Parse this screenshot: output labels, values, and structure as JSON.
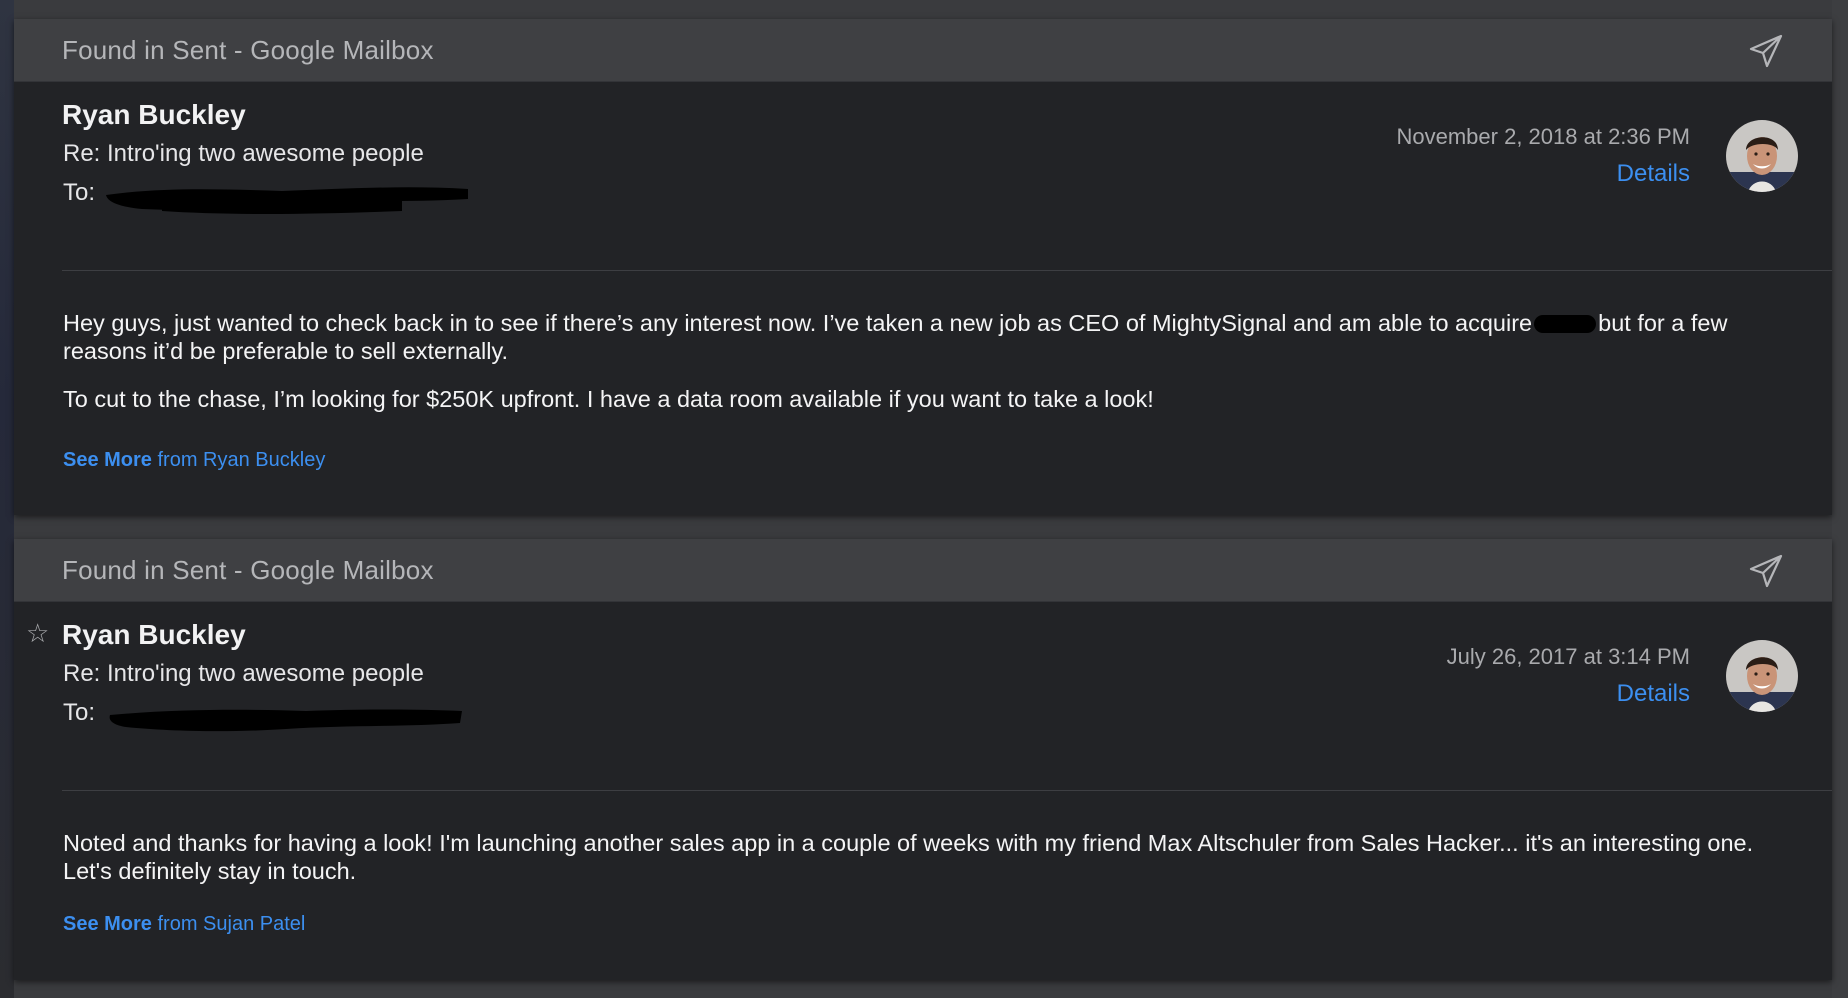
{
  "messages": [
    {
      "header": "Found in Sent - Google Mailbox",
      "sender": "Ryan Buckley",
      "subject": "Re: Intro'ing two awesome people",
      "to_label": "To:",
      "date": "November 2, 2018 at 2:36 PM",
      "details": "Details",
      "body_p1_a": "Hey guys, just wanted to check back in to see if there’s any interest now. I’ve taken a new job as CEO of MightySignal and am able to acquire",
      "body_p1_b": "but for a few reasons it’d be preferable to sell externally.",
      "body_p2": "To cut to the chase, I’m looking for $250K upfront. I have a data room available if you want to take a look!",
      "see_more_bold": "See More",
      "see_more_rest": "from Ryan Buckley",
      "starred": false
    },
    {
      "header": "Found in Sent - Google Mailbox",
      "sender": "Ryan Buckley",
      "subject": "Re: Intro'ing two awesome people",
      "to_label": "To:",
      "date": "July 26, 2017 at 3:14 PM",
      "details": "Details",
      "body_p1": "Noted and thanks for having a look! I'm launching another sales app in a couple of weeks with my friend Max Altschuler from Sales Hacker... it's an interesting one. Let's definitely stay in touch.",
      "see_more_bold": "See More",
      "see_more_rest": "from Sujan Patel",
      "star_glyph": "☆"
    }
  ],
  "colors": {
    "accent_link": "#3c8ff0",
    "card_bg": "#222326",
    "header_bg": "#3f4043"
  },
  "icons": [
    "send-icon",
    "star-icon",
    "avatar"
  ]
}
